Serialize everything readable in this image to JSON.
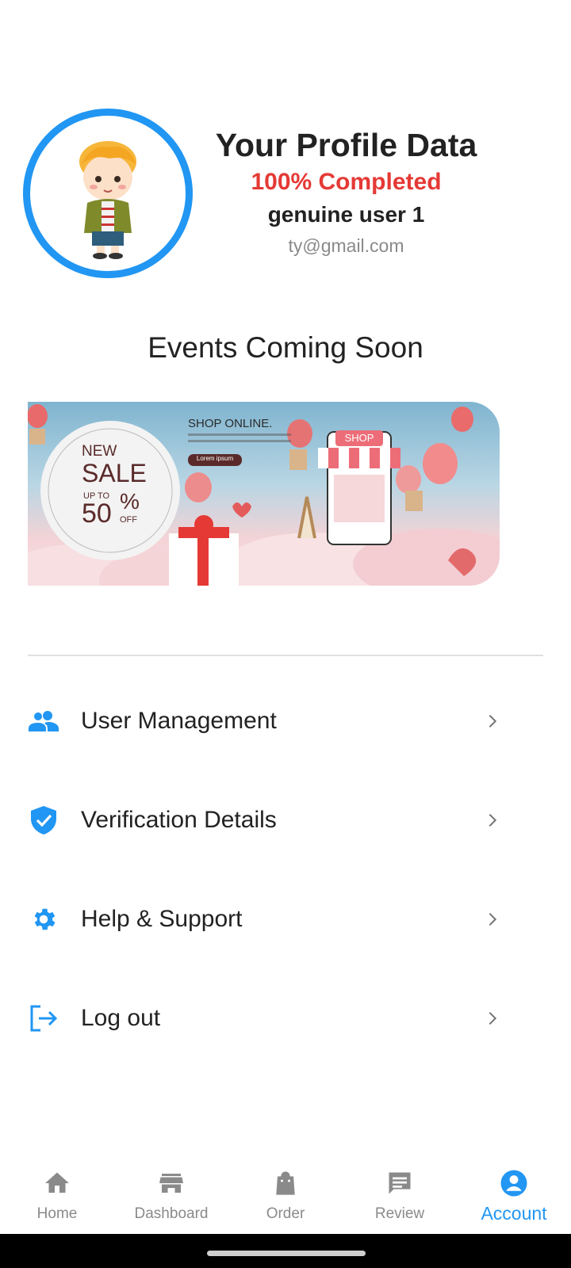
{
  "profile": {
    "title": "Your Profile Data",
    "completed": "100% Completed",
    "username": "genuine user 1",
    "email": "ty@gmail.com",
    "ring_color": "#2196f3"
  },
  "events": {
    "title": "Events Coming Soon",
    "banner": {
      "headline": "SHOP ONLINE.",
      "badge_new": "NEW",
      "badge_sale": "SALE",
      "badge_upto": "UP TO",
      "badge_number": "50",
      "badge_percent": "%",
      "badge_off": "OFF",
      "button_text": "Lorem ipsum",
      "store_sign": "SHOP"
    }
  },
  "menu": {
    "items": [
      {
        "label": "User Management",
        "icon": "people-icon"
      },
      {
        "label": "Verification Details",
        "icon": "verified-shield-icon"
      },
      {
        "label": "Help & Support",
        "icon": "gear-icon"
      },
      {
        "label": "Log out",
        "icon": "logout-icon"
      }
    ]
  },
  "bottom_nav": {
    "items": [
      {
        "label": "Home",
        "icon": "home-icon"
      },
      {
        "label": "Dashboard",
        "icon": "store-icon"
      },
      {
        "label": "Order",
        "icon": "shopping-bag-icon"
      },
      {
        "label": "Review",
        "icon": "comment-icon"
      },
      {
        "label": "Account",
        "icon": "account-circle-icon",
        "active": true
      }
    ],
    "active_color": "#2196f3",
    "inactive_color": "#8a8a8a"
  },
  "colors": {
    "accent": "#2196f3",
    "completed_red": "#e53935"
  }
}
